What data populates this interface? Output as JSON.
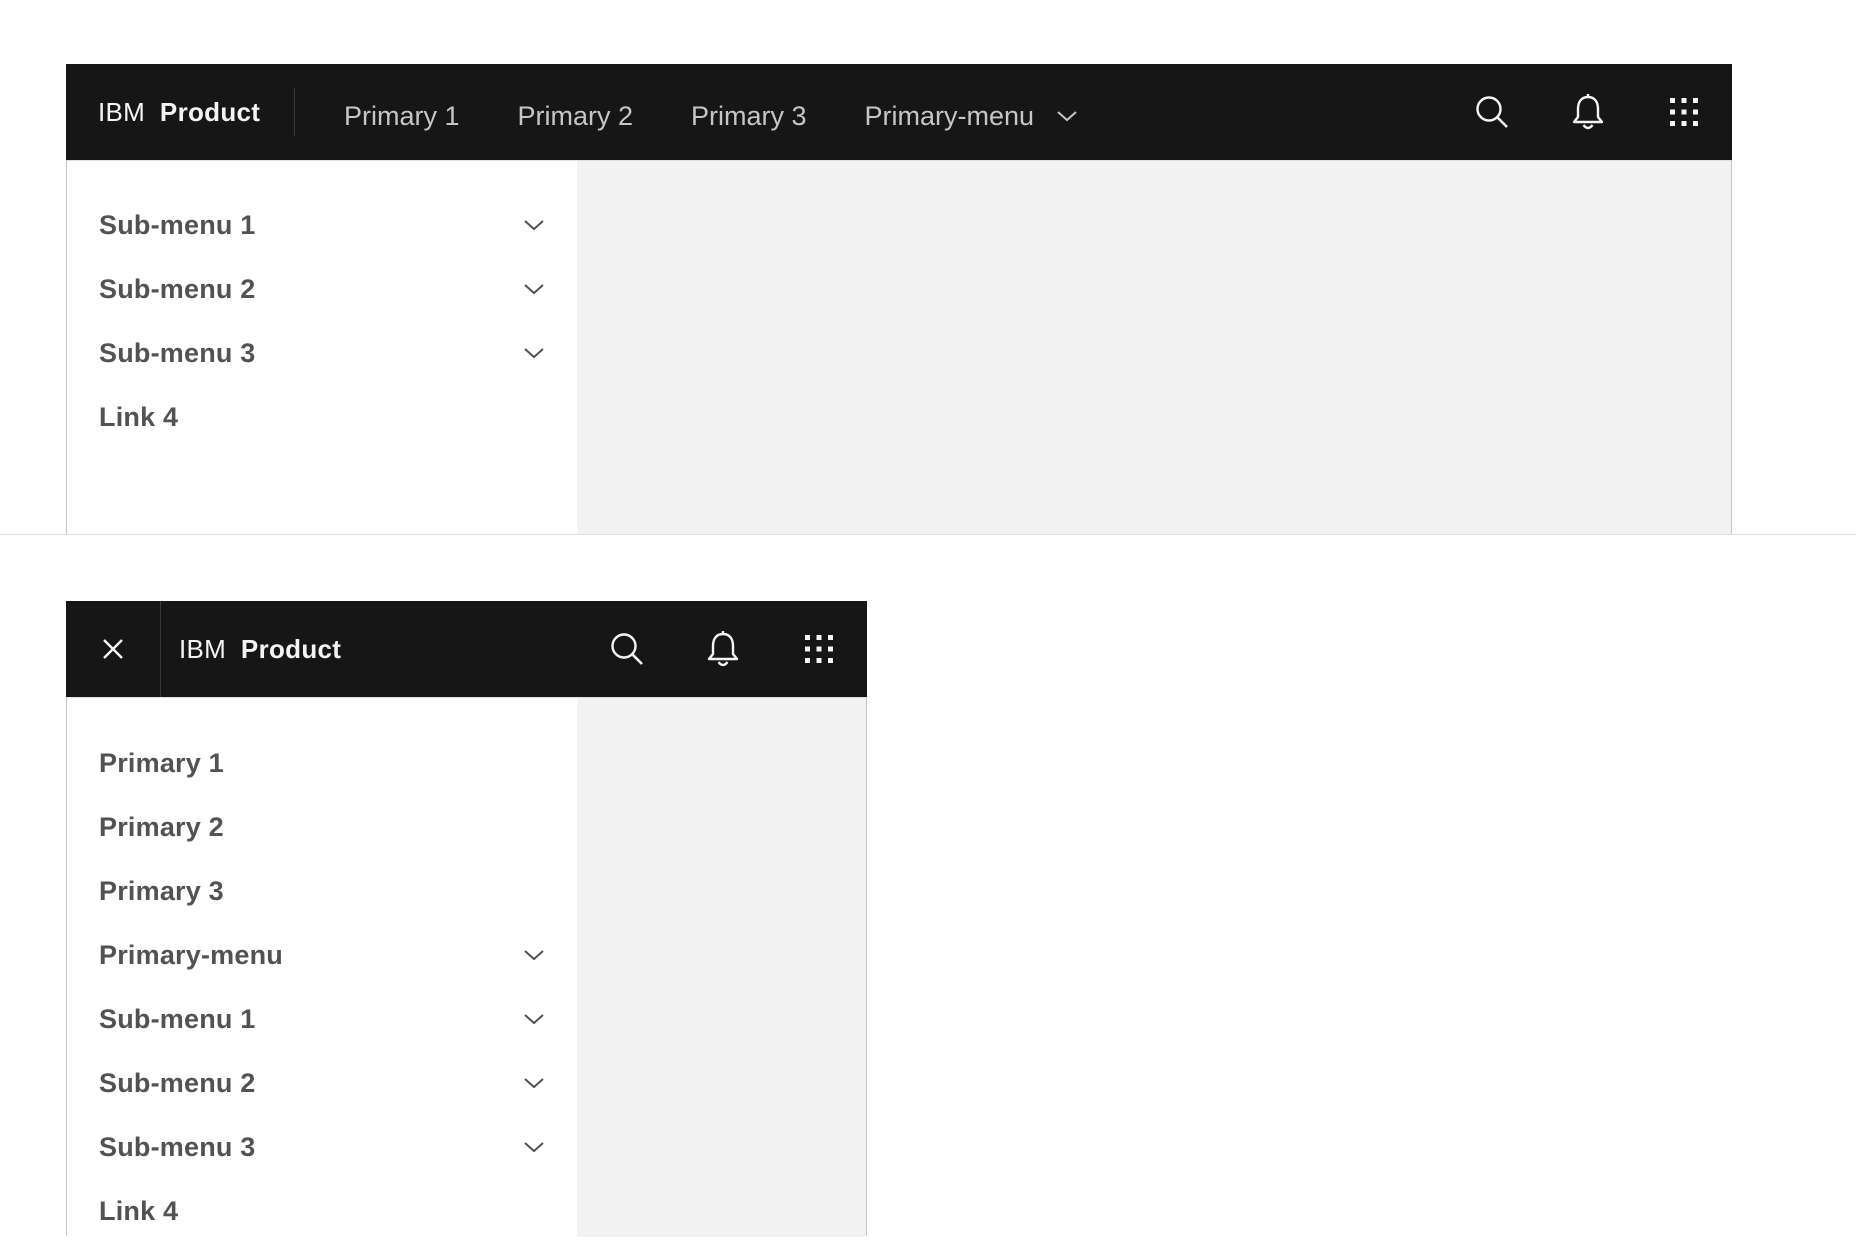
{
  "desktop": {
    "brand": {
      "prefix": "IBM",
      "name": "Product"
    },
    "nav": [
      {
        "label": "Primary 1",
        "has_menu": false
      },
      {
        "label": "Primary 2",
        "has_menu": false
      },
      {
        "label": "Primary 3",
        "has_menu": false
      },
      {
        "label": "Primary-menu",
        "has_menu": true
      }
    ],
    "actions": [
      "search-icon",
      "notification-icon",
      "app-switcher-icon"
    ],
    "side_nav": [
      {
        "label": "Sub-menu 1",
        "expandable": true
      },
      {
        "label": "Sub-menu 2",
        "expandable": true
      },
      {
        "label": "Sub-menu 3",
        "expandable": true
      },
      {
        "label": "Link 4",
        "expandable": false
      }
    ]
  },
  "mobile": {
    "toggle_icon": "close-icon",
    "brand": {
      "prefix": "IBM",
      "name": "Product"
    },
    "actions": [
      "search-icon",
      "notification-icon",
      "app-switcher-icon"
    ],
    "side_nav": [
      {
        "label": "Primary 1",
        "expandable": false
      },
      {
        "label": "Primary 2",
        "expandable": false
      },
      {
        "label": "Primary 3",
        "expandable": false
      },
      {
        "label": "Primary-menu",
        "expandable": true
      },
      {
        "label": "Sub-menu 1",
        "expandable": true
      },
      {
        "label": "Sub-menu 2",
        "expandable": true
      },
      {
        "label": "Sub-menu 3",
        "expandable": true
      },
      {
        "label": "Link 4",
        "expandable": false
      }
    ]
  },
  "colors": {
    "header_bg": "#161616",
    "header_text": "#f4f4f4",
    "nav_text": "#c6c6c6",
    "side_text": "#525252",
    "overlay_bg": "#f2f2f2"
  }
}
